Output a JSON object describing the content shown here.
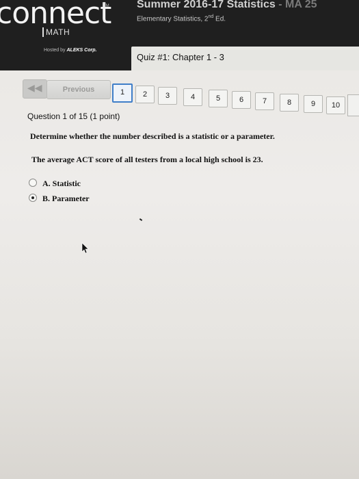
{
  "header": {
    "logo": "connect",
    "logo_tm": "TM",
    "product": "MATH",
    "hosted_prefix": "Hosted by",
    "hosted_brand": "ALEKS Corp.",
    "course_title": "Summer 2016-17 Statistics",
    "course_code": "- MA 25",
    "course_subtitle_main": "Elementary Statistics, 2",
    "course_subtitle_sup": "nd",
    "course_subtitle_end": " Ed.",
    "quiz_title": "Quiz #1: Chapter 1 - 3"
  },
  "navigation": {
    "previous_label": "Previous",
    "pages": [
      "1",
      "2",
      "3",
      "4",
      "5",
      "6",
      "7",
      "8",
      "9",
      "10"
    ],
    "current_page": "1"
  },
  "question": {
    "header": "Question 1 of 15 (1 point)",
    "prompt": "Determine whether the number described is a statistic or a parameter.",
    "statement": "The average ACT score of all testers from a local high school is 23.",
    "options": [
      {
        "label": "A. Statistic",
        "selected": false
      },
      {
        "label": "B. Parameter",
        "selected": true
      }
    ]
  }
}
